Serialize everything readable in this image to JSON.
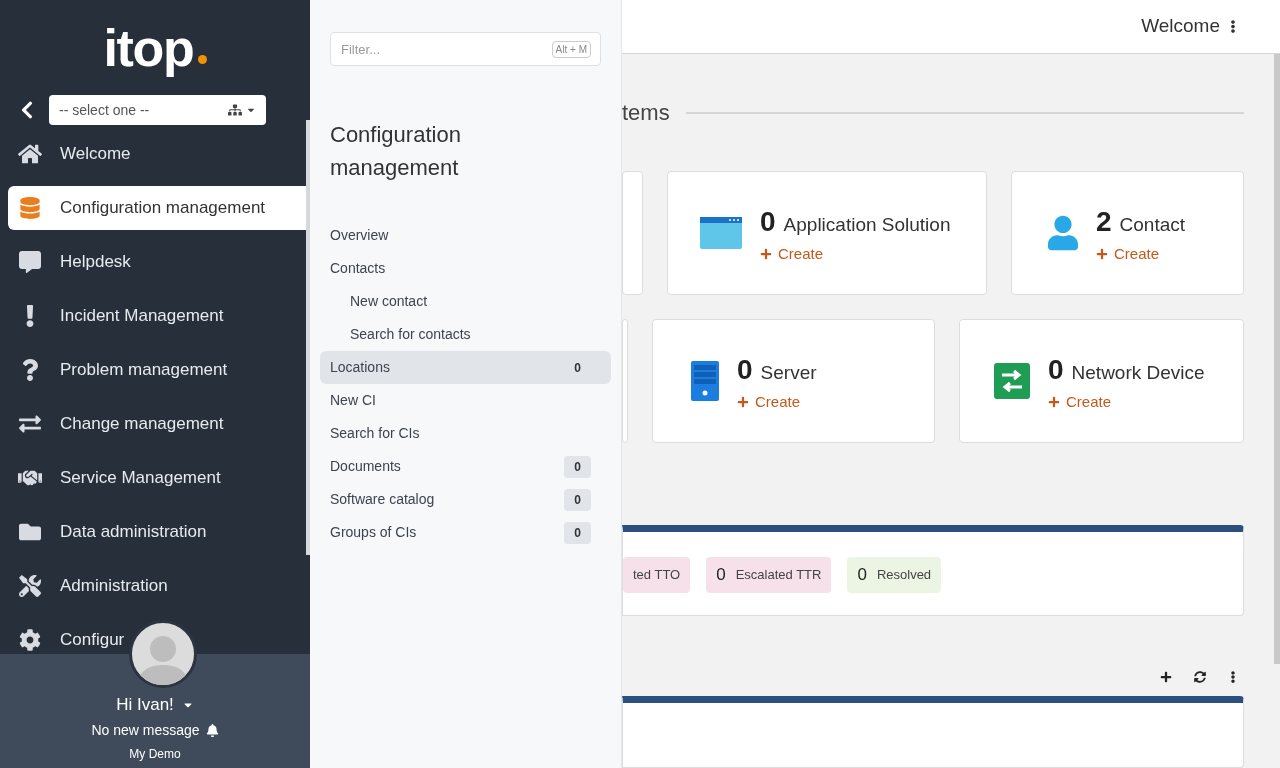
{
  "logo": "itop",
  "org_select": {
    "value": "-- select one --"
  },
  "sidebar": {
    "items": [
      {
        "label": "Welcome",
        "selected": false
      },
      {
        "label": "Configuration management",
        "selected": true
      },
      {
        "label": "Helpdesk",
        "selected": false
      },
      {
        "label": "Incident Management",
        "selected": false
      },
      {
        "label": "Problem management",
        "selected": false
      },
      {
        "label": "Change management",
        "selected": false
      },
      {
        "label": "Service Management",
        "selected": false
      },
      {
        "label": "Data administration",
        "selected": false
      },
      {
        "label": "Administration",
        "selected": false
      },
      {
        "label": "Configur",
        "selected": false
      }
    ]
  },
  "user": {
    "greeting": "Hi Ivan!",
    "messages": "No new message",
    "org": "My Demo"
  },
  "submenu": {
    "filter": {
      "placeholder": "Filter...",
      "shortcut": "Alt + M"
    },
    "title": "Configuration management",
    "items": [
      {
        "label": "Overview",
        "selected": false
      },
      {
        "label": "Contacts",
        "selected": false,
        "children": [
          {
            "label": "New contact",
            "selected": false
          },
          {
            "label": "Search for contacts",
            "selected": false
          }
        ]
      },
      {
        "label": "Locations",
        "selected": true,
        "count": "0"
      },
      {
        "label": "New CI",
        "selected": false
      },
      {
        "label": "Search for CIs",
        "selected": false
      },
      {
        "label": "Documents",
        "selected": false,
        "count": "0"
      },
      {
        "label": "Software catalog",
        "selected": false,
        "count": "0"
      },
      {
        "label": "Groups of CIs",
        "selected": false,
        "count": "0"
      }
    ]
  },
  "header": {
    "title": "Welcome"
  },
  "section_title": "tems",
  "card_rows": [
    [
      {
        "count": "0",
        "label": "Application Solution",
        "action": "Create"
      },
      {
        "count": "2",
        "label": "Contact",
        "action": "Create"
      }
    ],
    [
      {
        "count": "0",
        "label": "Server",
        "action": "Create"
      },
      {
        "count": "0",
        "label": "Network Device",
        "action": "Create"
      }
    ]
  ],
  "status_badges": [
    {
      "label": "ted TTO",
      "color": "#f6e1ea"
    },
    {
      "count": "0",
      "label": "Escalated TTR",
      "color": "#f6e1ea"
    },
    {
      "count": "0",
      "label": "Resolved",
      "color": "#ecf5e4"
    }
  ]
}
